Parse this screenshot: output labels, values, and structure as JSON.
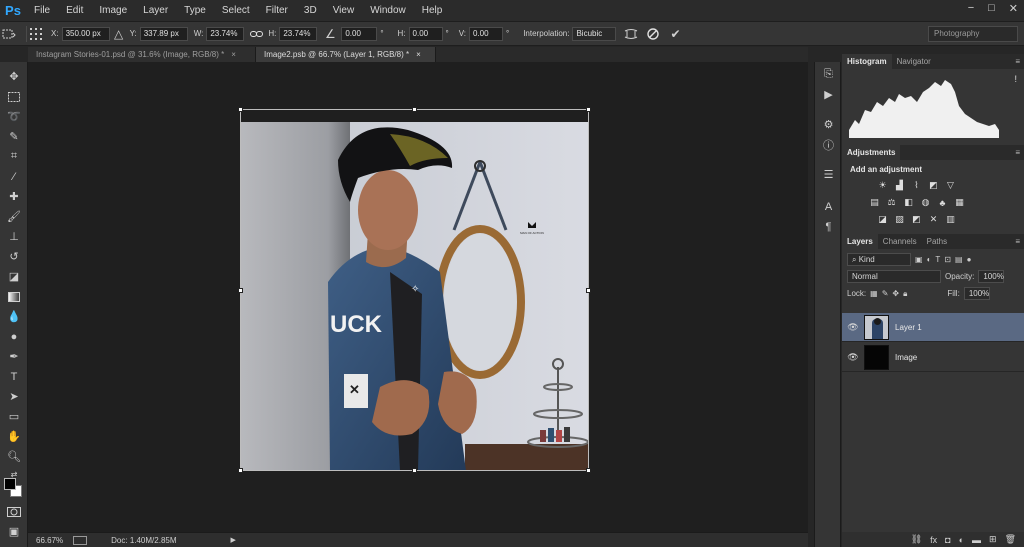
{
  "app": {
    "logo": "Ps"
  },
  "menu": [
    "File",
    "Edit",
    "Image",
    "Layer",
    "Type",
    "Select",
    "Filter",
    "3D",
    "View",
    "Window",
    "Help"
  ],
  "window_controls": {
    "minimize": "−",
    "restore": "□",
    "close": "✕"
  },
  "options": {
    "x_label": "X:",
    "x_value": "350.00 px",
    "y_label": "Y:",
    "y_value": "337.89 px",
    "w_label": "W:",
    "w_value": "23.74%",
    "h_label": "H:",
    "h_value": "23.74%",
    "angle_value": "0.00",
    "angle_unit": "°",
    "hskew_label": "H:",
    "hskew_value": "0.00",
    "hskew_unit": "°",
    "vskew_label": "V:",
    "vskew_value": "0.00",
    "vskew_unit": "°",
    "interp_label": "Interpolation:",
    "interp_value": "Bicubic",
    "workspace": "Photography"
  },
  "tabs": [
    {
      "label": "Instagram Stories-01.psd @ 31.6% (Image, RGB/8) *",
      "close": "×"
    },
    {
      "label": "Image2.psb @ 66.7% (Layer 1, RGB/8) *",
      "close": "×"
    }
  ],
  "status": {
    "zoom": "66.67%",
    "doc": "Doc: 1.40M/2.85M",
    "arrow": "▶"
  },
  "histogram": {
    "tabs": [
      "Histogram",
      "Navigator"
    ],
    "warning": "!"
  },
  "adjustments": {
    "tab": "Adjustments",
    "title": "Add an adjustment"
  },
  "layers": {
    "tabs": [
      "Layers",
      "Channels",
      "Paths"
    ],
    "kind": "Kind",
    "blend": "Normal",
    "opacity_label": "Opacity:",
    "opacity_value": "100%",
    "lock_label": "Lock:",
    "fill_label": "Fill:",
    "fill_value": "100%",
    "items": [
      {
        "name": "Layer 1",
        "selected": true
      },
      {
        "name": "Image",
        "selected": false
      }
    ]
  },
  "photo": {
    "watermark": "MAN OF ACTION"
  },
  "colors": {
    "accent": "#31a8ff",
    "selection": "#5a6983"
  }
}
